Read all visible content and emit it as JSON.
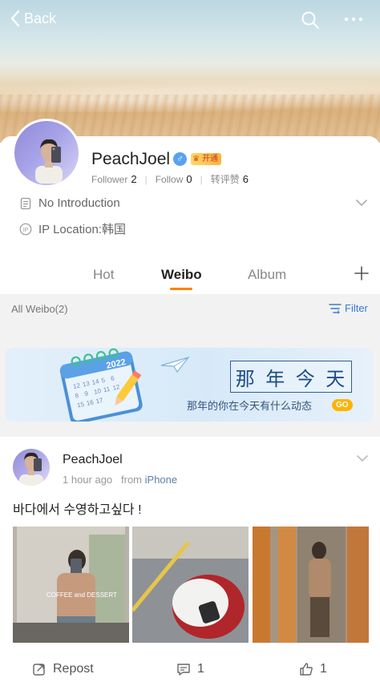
{
  "header": {
    "back_label": "Back",
    "icons": [
      "chevron-left-icon",
      "search-icon",
      "more-icon"
    ]
  },
  "profile": {
    "name": "PeachJoel",
    "vip_label": "开通",
    "follower_label": "Follower",
    "follower_count": "2",
    "follow_label": "Follow",
    "follow_count": "0",
    "repost_like_label": "转评赞",
    "repost_like_count": "6",
    "intro": "No Introduction",
    "ip_location": "IP Location:韩国"
  },
  "tabs": [
    {
      "label": "Hot",
      "active": false
    },
    {
      "label": "Weibo",
      "active": true
    },
    {
      "label": "Album",
      "active": false
    }
  ],
  "filterbar": {
    "all_label": "All Weibo(2)",
    "filter_label": "Filter"
  },
  "promo": {
    "title_chars": [
      "那",
      "年",
      "今",
      "天"
    ],
    "subtitle": "那年的你在今天有什么动态",
    "go_label": "GO",
    "calendar_year": "2022"
  },
  "post": {
    "author": "PeachJoel",
    "time": "1 hour ago",
    "from_prefix": "from",
    "source": "iPhone",
    "text": "바다에서 수영하고싶다 !",
    "photo1_caption": "COFFEE and DESSERT",
    "repost_label": "Repost",
    "comment_count": "1",
    "like_count": "1"
  },
  "colors": {
    "accent": "#ff8200",
    "link": "#3a7bd5",
    "gender": "#5aa2f0",
    "promo_title": "#1f4d88"
  }
}
